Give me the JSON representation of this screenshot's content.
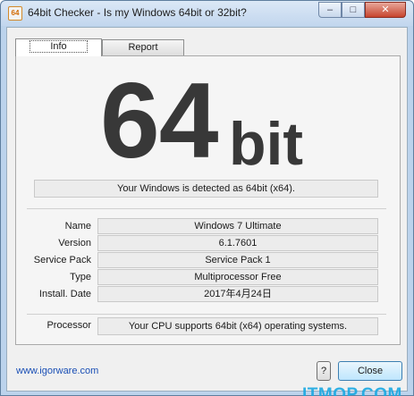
{
  "window": {
    "title": "64bit Checker - Is my Windows 64bit or 32bit?",
    "icon_text": "64",
    "min_glyph": "–",
    "max_glyph": "□",
    "close_glyph": "✕"
  },
  "tabs": [
    {
      "label": "Info",
      "selected": true
    },
    {
      "label": "Report",
      "selected": false
    }
  ],
  "result": {
    "big_number": "64",
    "big_unit": "bit",
    "detection_text": "Your Windows is detected as 64bit (x64)."
  },
  "info_rows": [
    {
      "label": "Name",
      "value": "Windows 7 Ultimate"
    },
    {
      "label": "Version",
      "value": "6.1.7601"
    },
    {
      "label": "Service Pack",
      "value": "Service Pack 1"
    },
    {
      "label": "Type",
      "value": "Multiprocessor Free"
    },
    {
      "label": "Install. Date",
      "value": "2017年4月24日"
    }
  ],
  "processor": {
    "label": "Processor",
    "value": "Your CPU supports 64bit (x64) operating systems."
  },
  "footer": {
    "link_text": "www.igorware.com",
    "help_label": "?",
    "close_label": "Close"
  },
  "watermark": "ITMOP.COM",
  "colors": {
    "frame": "#bcd3ec",
    "big_text": "#383838",
    "link": "#1a4fb5",
    "watermark": "#1aa8e2"
  }
}
